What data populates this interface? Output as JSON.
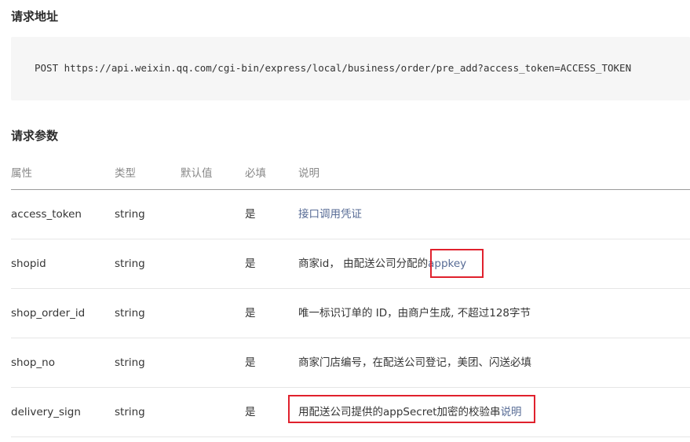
{
  "sections": {
    "request_address_title": "请求地址",
    "request_params_title": "请求参数"
  },
  "request": {
    "url_line": "POST https://api.weixin.qq.com/cgi-bin/express/local/business/order/pre_add?access_token=ACCESS_TOKEN"
  },
  "table": {
    "headers": {
      "name": "属性",
      "type": "类型",
      "default": "默认值",
      "required": "必填",
      "description": "说明"
    },
    "rows": [
      {
        "name": "access_token",
        "type": "string",
        "default": "",
        "required": "是",
        "description": "接口调用凭证"
      },
      {
        "name": "shopid",
        "type": "string",
        "default": "",
        "required": "是",
        "description_prefix": "商家id， 由配送公司分配的",
        "description_suffix": "appkey"
      },
      {
        "name": "shop_order_id",
        "type": "string",
        "default": "",
        "required": "是",
        "description": "唯一标识订单的 ID，由商户生成, 不超过128字节"
      },
      {
        "name": "shop_no",
        "type": "string",
        "default": "",
        "required": "是",
        "description": "商家门店编号，在配送公司登记，美团、闪送必填"
      },
      {
        "name": "delivery_sign",
        "type": "string",
        "default": "",
        "required": "是",
        "description_prefix": "用配送公司提供的appSecret加密的校验串",
        "description_link": "说明"
      }
    ]
  },
  "colors": {
    "highlight": "#e0212d",
    "link": "#576b95",
    "code_bg": "#f6f6f6"
  }
}
